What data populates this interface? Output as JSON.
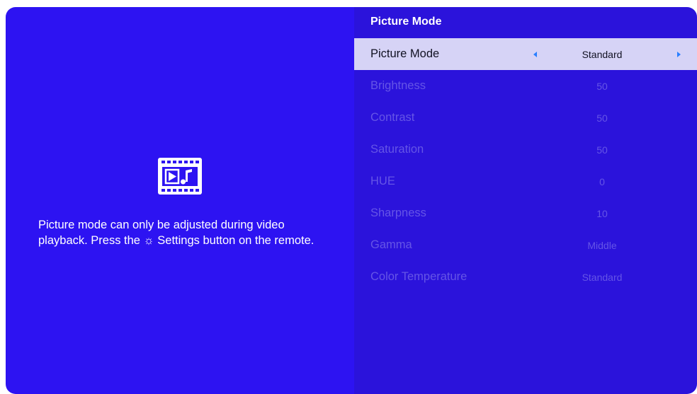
{
  "colors": {
    "left_bg": "#2d13f2",
    "right_bg": "#2b13db",
    "selected_bg": "#d6d3f6",
    "disabled_text": "#6555e6",
    "arrow": "#2a7fff"
  },
  "info": {
    "icon": "video-film-icon",
    "message": "Picture mode can only be adjusted during video playback. Press the ☼ Settings button on the remote."
  },
  "panel": {
    "title": "Picture Mode",
    "items": [
      {
        "label": "Picture Mode",
        "value": "Standard",
        "selected": true
      },
      {
        "label": "Brightness",
        "value": "50"
      },
      {
        "label": "Contrast",
        "value": "50"
      },
      {
        "label": "Saturation",
        "value": "50"
      },
      {
        "label": "HUE",
        "value": "0"
      },
      {
        "label": "Sharpness",
        "value": "10"
      },
      {
        "label": "Gamma",
        "value": "Middle"
      },
      {
        "label": "Color Temperature",
        "value": "Standard"
      }
    ]
  }
}
